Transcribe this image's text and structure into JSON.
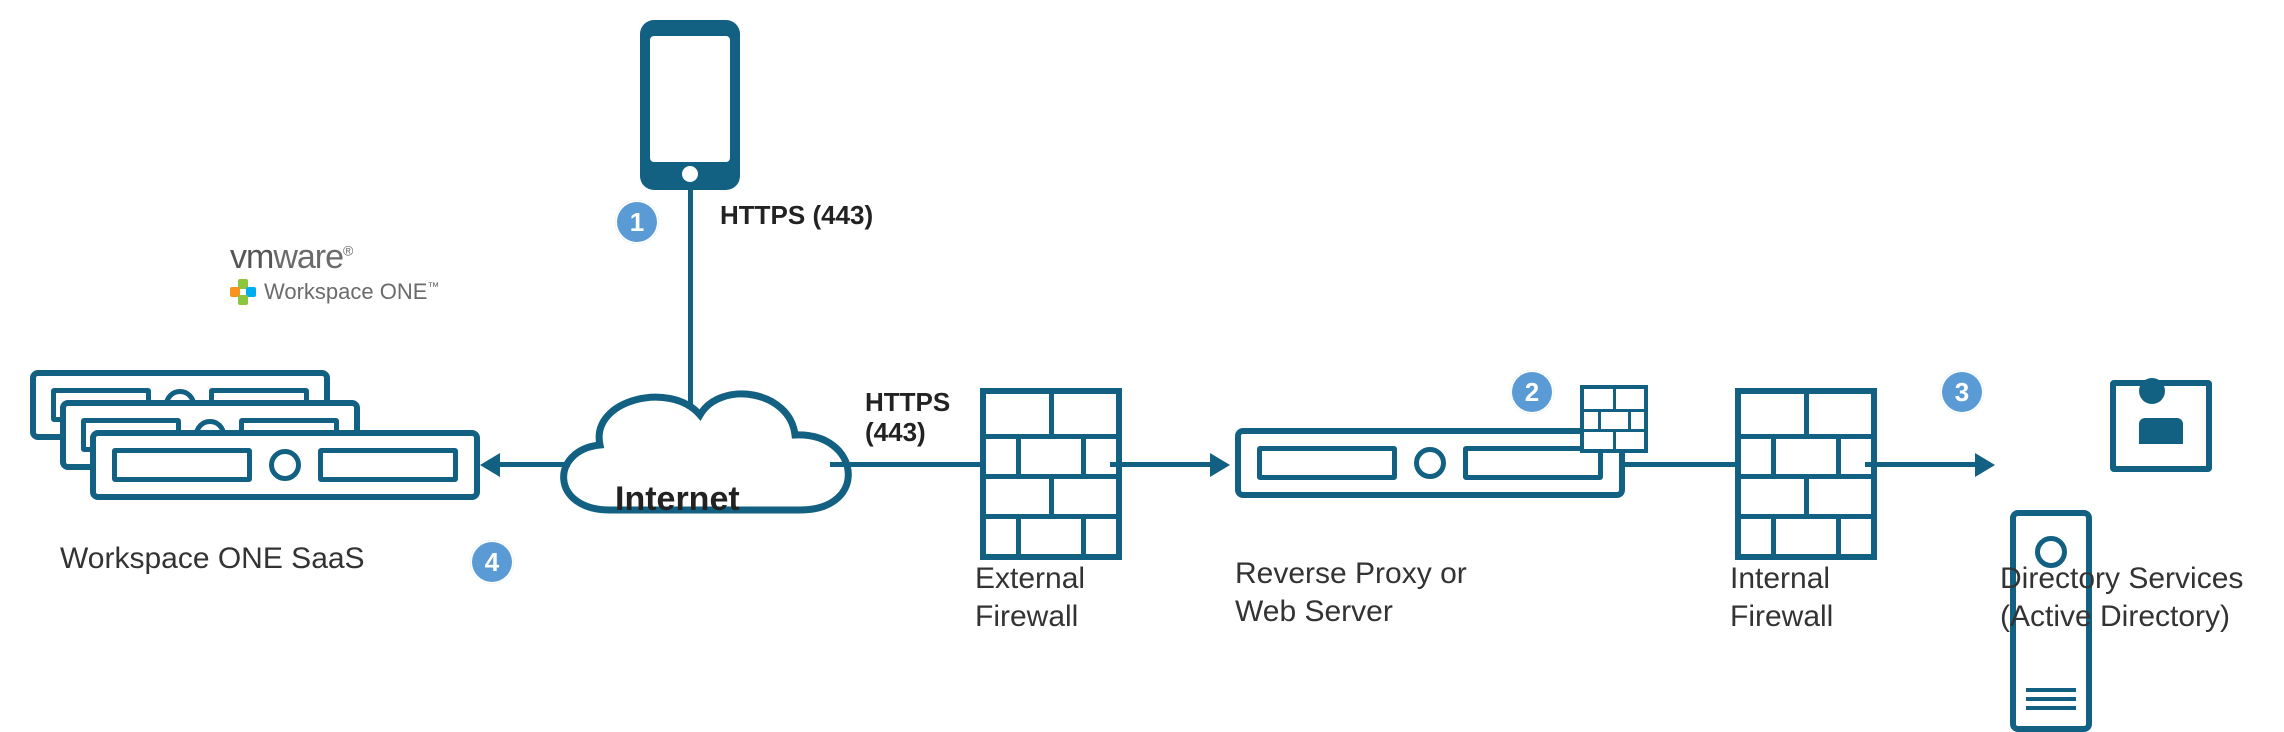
{
  "logo": {
    "vendor_prefix": "vm",
    "vendor_suffix": "ware",
    "registered": "®",
    "product": "Workspace ONE",
    "tm": "™"
  },
  "nodes": {
    "saas": {
      "label": "Workspace ONE SaaS"
    },
    "internet": {
      "label": "Internet"
    },
    "ext_fw": {
      "label_line1": "External",
      "label_line2": "Firewall"
    },
    "rev_proxy": {
      "label_line1": "Reverse Proxy or",
      "label_line2": "Web Server"
    },
    "int_fw": {
      "label_line1": "Internal",
      "label_line2": "Firewall"
    },
    "dir": {
      "label_line1": "Directory Services",
      "label_line2": "(Active Directory)"
    }
  },
  "links": {
    "device_to_internet": {
      "label": "HTTPS (443)"
    },
    "internet_to_extfw": {
      "label_line1": "HTTPS",
      "label_line2": "(443)"
    }
  },
  "badges": {
    "one": "1",
    "two": "2",
    "three": "3",
    "four": "4"
  }
}
